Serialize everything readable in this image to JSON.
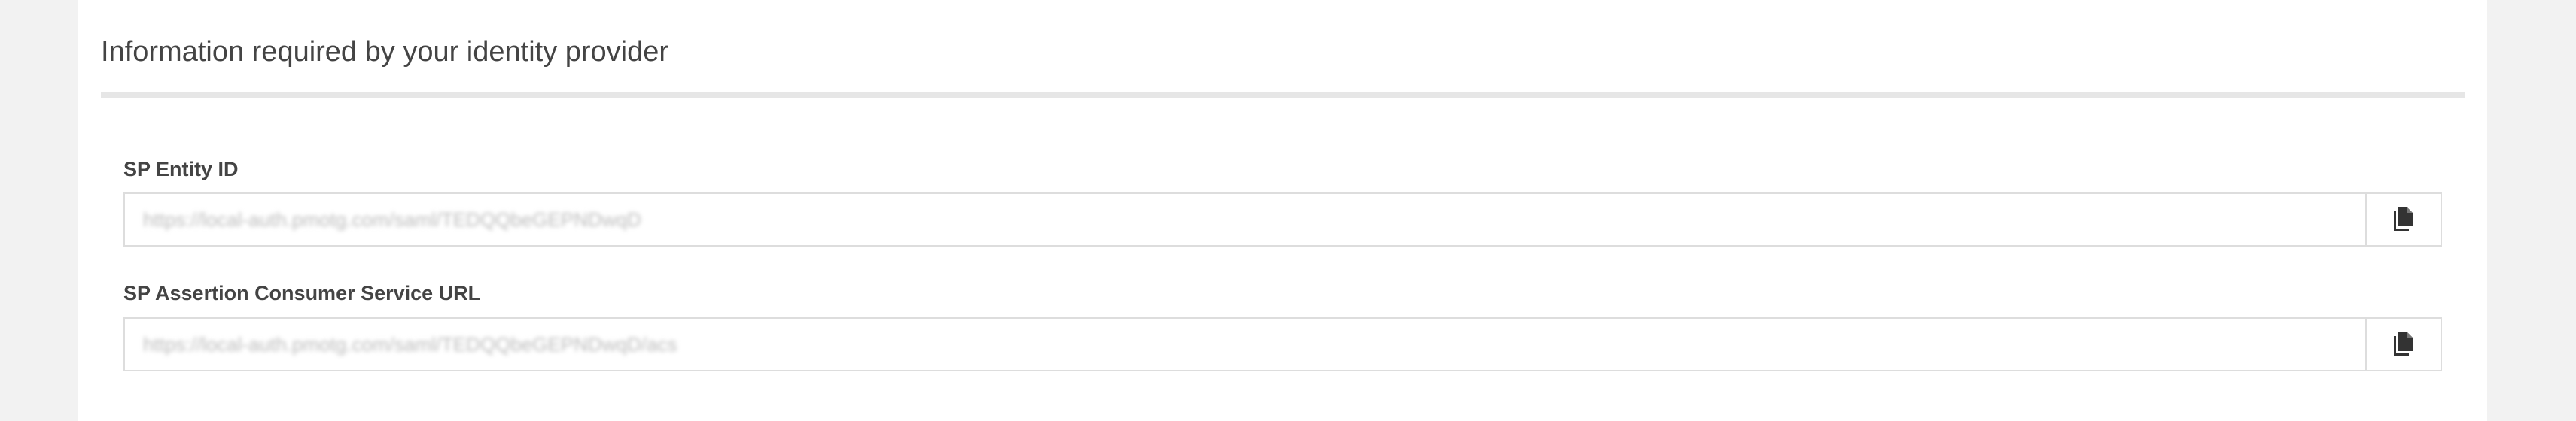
{
  "section": {
    "title": "Information required by your identity provider"
  },
  "fields": {
    "entity_id": {
      "label": "SP Entity ID",
      "value": "https://local-auth.pmotg.com/saml/TEDQQbeGEPNDwqD"
    },
    "acs_url": {
      "label": "SP Assertion Consumer Service URL",
      "value": "https://local-auth.pmotg.com/saml/TEDQQbeGEPNDwqD/acs"
    }
  },
  "icons": {
    "copy": "copy-icon"
  },
  "colors": {
    "page_background": "#f2f2f2",
    "panel_background": "#ffffff",
    "text": "#444444",
    "border": "#dddddd"
  }
}
